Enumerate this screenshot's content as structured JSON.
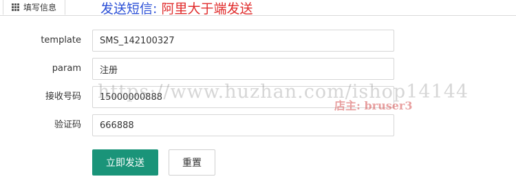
{
  "tab": {
    "label": "填写信息",
    "icon": "grid-icon"
  },
  "heading": {
    "prefix": "发送短信",
    "separator": ": ",
    "provider": "阿里大于端发送"
  },
  "form": {
    "fields": [
      {
        "label": "template",
        "value": "SMS_142100327"
      },
      {
        "label": "param",
        "value": "注册"
      },
      {
        "label": "接收号码",
        "value": "15000000888"
      },
      {
        "label": "验证码",
        "value": "666888"
      }
    ]
  },
  "buttons": {
    "submit": "立即发送",
    "reset": "重置"
  },
  "watermark": {
    "text": "https://www.huzhan.com/ishop14144",
    "signature": "店主: bruser3"
  },
  "colors": {
    "heading": "#2b4fd6",
    "heading_accent": "#e02b2b",
    "primary": "#1a9479"
  }
}
